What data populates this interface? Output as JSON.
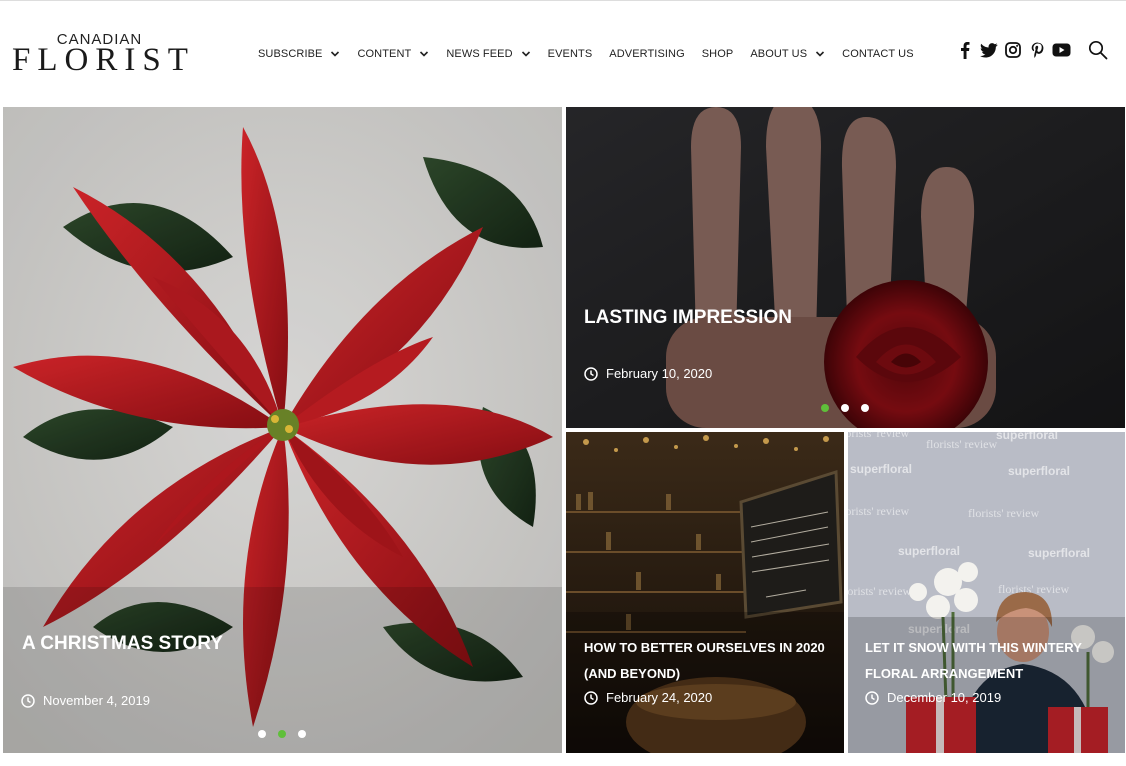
{
  "logo": {
    "top": "CANADIAN",
    "main": "FLORIST"
  },
  "nav": [
    {
      "label": "SUBSCRIBE",
      "dropdown": true
    },
    {
      "label": "CONTENT",
      "dropdown": true
    },
    {
      "label": "NEWS FEED",
      "dropdown": true
    },
    {
      "label": "EVENTS",
      "dropdown": false
    },
    {
      "label": "ADVERTISING",
      "dropdown": false
    },
    {
      "label": "SHOP",
      "dropdown": false
    },
    {
      "label": "ABOUT US",
      "dropdown": true
    },
    {
      "label": "CONTACT US",
      "dropdown": false
    }
  ],
  "social": [
    "facebook-icon",
    "twitter-icon",
    "instagram-icon",
    "pinterest-icon",
    "youtube-icon"
  ],
  "colors": {
    "accent": "#5fbf3a",
    "text": "#222222",
    "overlay_text": "#ffffff"
  },
  "cards": {
    "poinsettia": {
      "title": "A CHRISTMAS STORY",
      "date": "November 4, 2019",
      "slides": 3,
      "active_slide": 2
    },
    "rose": {
      "title": "LASTING IMPRESSION",
      "date": "February 10, 2020",
      "slides": 3,
      "active_slide": 1
    },
    "bar": {
      "title": "HOW TO BETTER OURSELVES IN 2020 (AND BEYOND)",
      "date": "February 24, 2020"
    },
    "florist": {
      "title": "LET IT SNOW WITH THIS WINTERY FLORAL ARRANGEMENT",
      "date": "December 10, 2019"
    }
  },
  "watermarks": {
    "brand1": "florists' review",
    "brand2": "superfloral"
  }
}
